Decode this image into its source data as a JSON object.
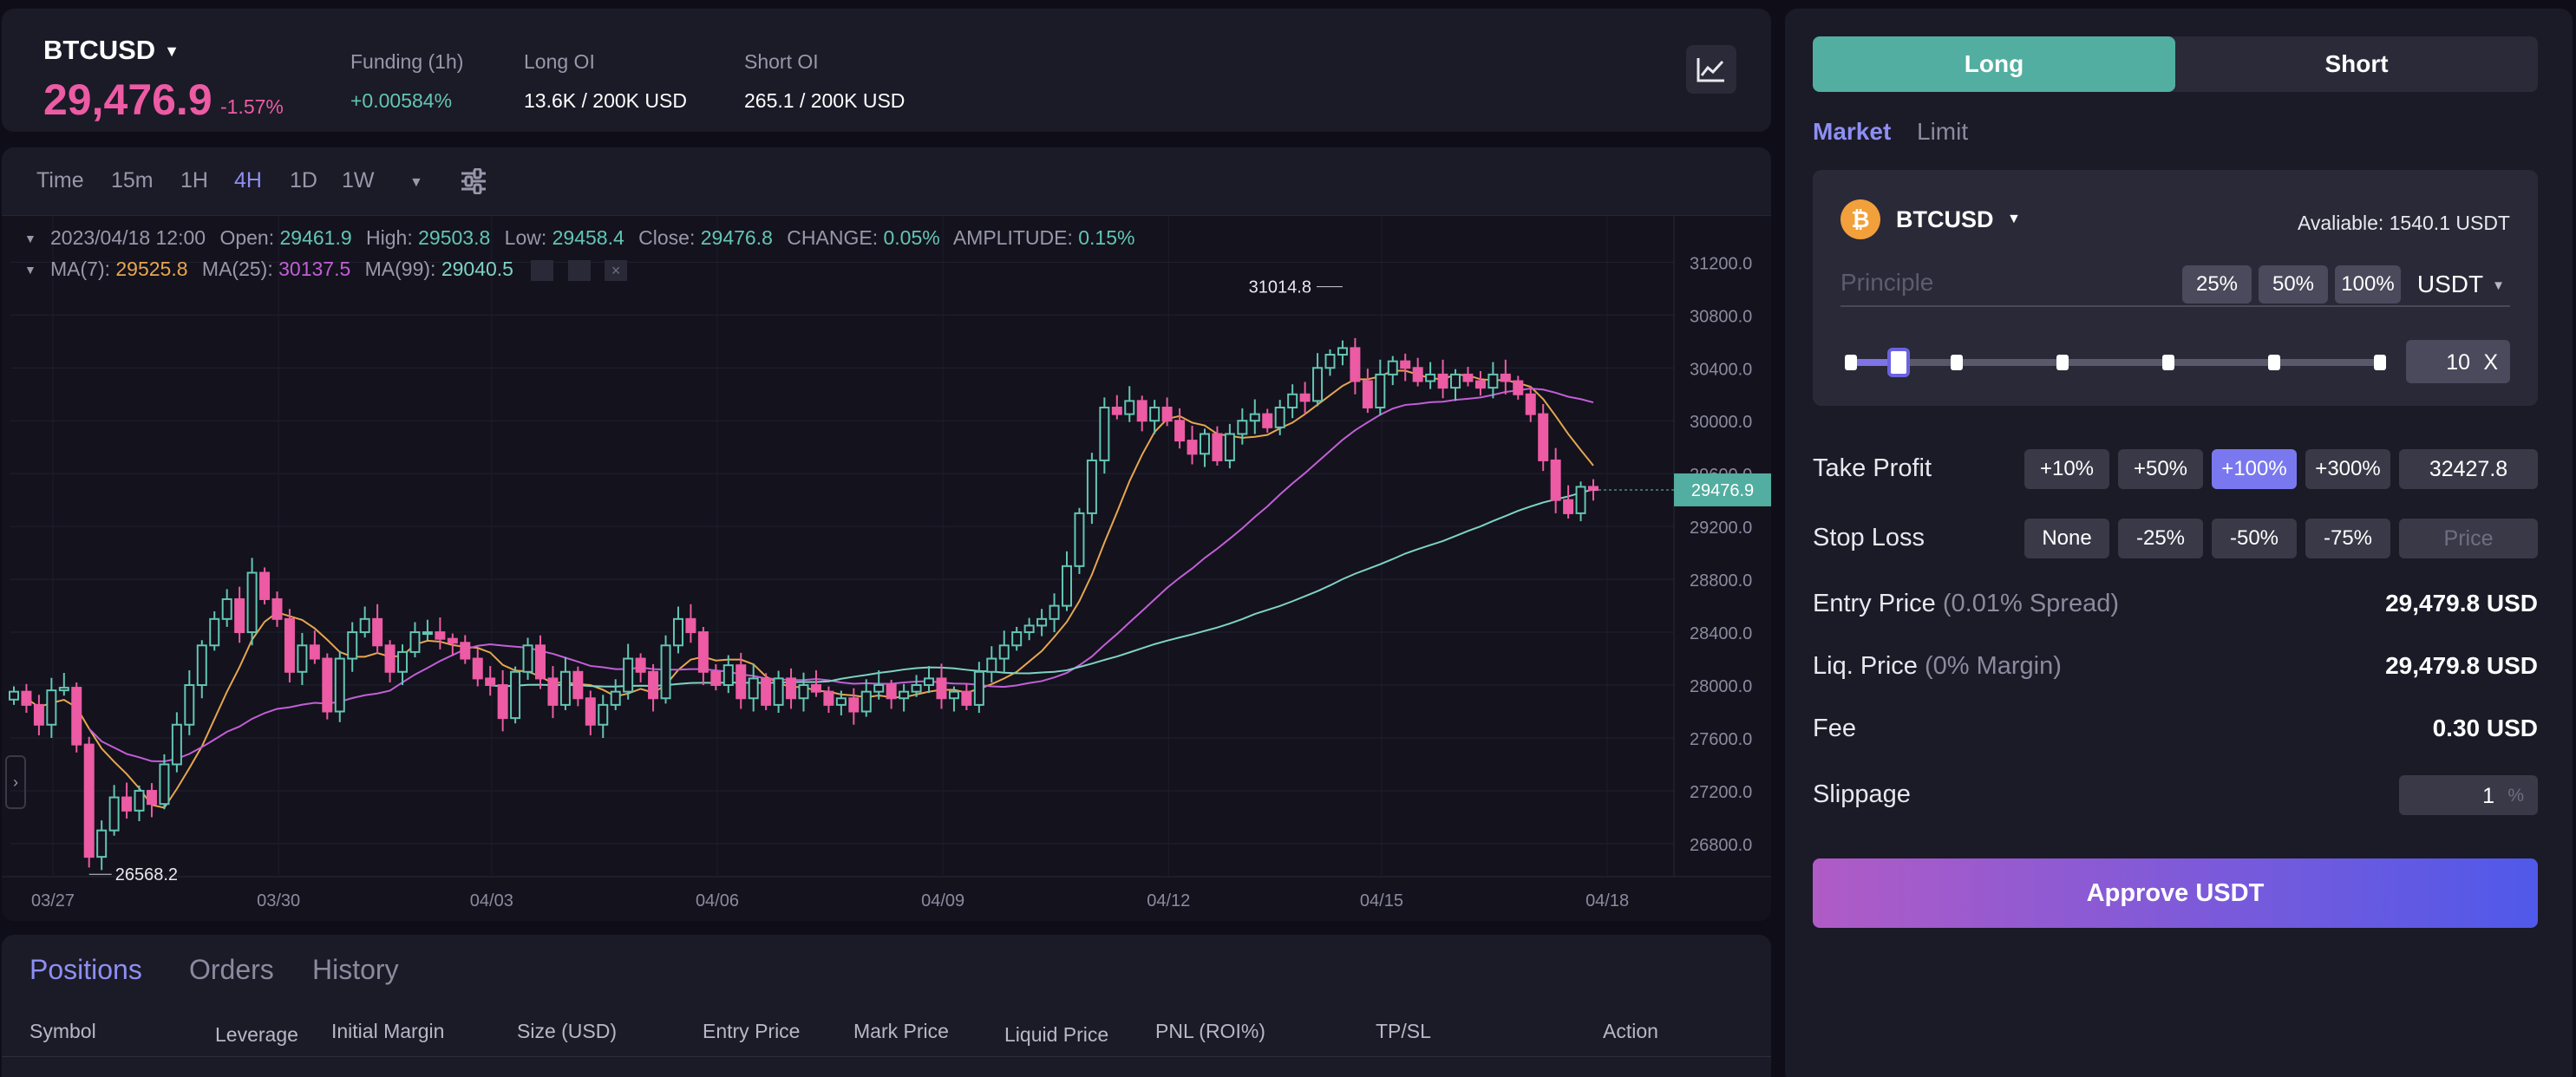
{
  "ticker": {
    "symbol": "BTCUSD",
    "price": "29,476.9",
    "change": "-1.57%",
    "funding_label": "Funding (1h)",
    "funding_value": "+0.00584%",
    "long_oi_label": "Long OI",
    "long_oi_value": "13.6K / 200K USD",
    "short_oi_label": "Short OI",
    "short_oi_value": "265.1 / 200K USD"
  },
  "toolbar": {
    "timeframes": [
      "Time",
      "15m",
      "1H",
      "4H",
      "1D",
      "1W"
    ],
    "active_timeframe": "4H"
  },
  "legend": {
    "date": "2023/04/18 12:00",
    "open_label": "Open:",
    "open": "29461.9",
    "high_label": "High:",
    "high": "29503.8",
    "low_label": "Low:",
    "low": "29458.4",
    "close_label": "Close:",
    "close": "29476.8",
    "change_label": "CHANGE:",
    "change": "0.05%",
    "amp_label": "AMPLITUDE:",
    "amplitude": "0.15%",
    "ma7_label": "MA(7):",
    "ma7": "29525.8",
    "ma25_label": "MA(25):",
    "ma25": "30137.5",
    "ma99_label": "MA(99):",
    "ma99": "29040.5"
  },
  "chart_data": {
    "type": "candlestick",
    "x_tick_labels": [
      "03/27",
      "03/30",
      "04/03",
      "04/06",
      "04/09",
      "04/12",
      "04/15",
      "04/18"
    ],
    "y_tick_labels": [
      "31200.0",
      "30800.0",
      "30400.0",
      "30000.0",
      "29600.0",
      "29200.0",
      "28800.0",
      "28400.0",
      "28000.0",
      "27600.0",
      "27200.0",
      "26800.0"
    ],
    "ylim": [
      26550,
      31550
    ],
    "last_price_label": "29476.9",
    "max_annotation": "31014.8",
    "min_annotation": "26568.2",
    "close_series": [
      27950,
      27850,
      27700,
      27960,
      27980,
      27550,
      26700,
      26900,
      27150,
      27050,
      27200,
      27100,
      27400,
      27700,
      28000,
      28300,
      28500,
      28650,
      28400,
      28850,
      28650,
      28500,
      28100,
      28300,
      28200,
      27800,
      28200,
      28400,
      28500,
      28300,
      28100,
      28250,
      28400,
      28400,
      28350,
      28320,
      28200,
      28050,
      28000,
      27750,
      28100,
      28300,
      28050,
      27850,
      28100,
      27900,
      27700,
      27850,
      27950,
      28200,
      28100,
      27900,
      28300,
      28500,
      28400,
      28100,
      28000,
      28150,
      27900,
      28050,
      27850,
      28050,
      27900,
      28000,
      27950,
      27850,
      27900,
      27800,
      27950,
      28000,
      27900,
      27950,
      28000,
      28050,
      27900,
      27950,
      27850,
      28100,
      28200,
      28300,
      28400,
      28450,
      28500,
      28600,
      28900,
      29300,
      29700,
      30100,
      30050,
      30150,
      30000,
      30100,
      30000,
      29850,
      29750,
      29900,
      29700,
      29900,
      30000,
      30050,
      29950,
      30100,
      30200,
      30150,
      30400,
      30500,
      30550,
      30300,
      30100,
      30350,
      30450,
      30400,
      30300,
      30350,
      30250,
      30350,
      30300,
      30250,
      30350,
      30300,
      30200,
      30050,
      29700,
      29400,
      29300,
      29500,
      29476
    ]
  },
  "positions": {
    "tabs": [
      "Positions",
      "Orders",
      "History"
    ],
    "columns": [
      "Symbol",
      "Leverage",
      "Initial Margin",
      "Size (USD)",
      "Entry Price",
      "Mark Price",
      "Liquid Price",
      "PNL (ROI%)",
      "TP/SL",
      "Action"
    ]
  },
  "trade": {
    "long_label": "Long",
    "short_label": "Short",
    "order_tabs": [
      "Market",
      "Limit"
    ],
    "coin": "BTCUSD",
    "coin_icon_glyph": "₿",
    "available": "Avaliable: 1540.1 USDT",
    "principle_placeholder": "Principle",
    "pct_buttons": [
      "25%",
      "50%",
      "100%"
    ],
    "currency": "USDT",
    "leverage": "10",
    "leverage_suffix": "X",
    "leverage_fraction": 0.09,
    "take_profit_label": "Take Profit",
    "tp_options": [
      "+10%",
      "+50%",
      "+100%",
      "+300%"
    ],
    "tp_active": "+100%",
    "tp_value": "32427.8",
    "stop_loss_label": "Stop Loss",
    "sl_options": [
      "None",
      "-25%",
      "-50%",
      "-75%"
    ],
    "sl_placeholder": "Price",
    "entry_label": "Entry Price",
    "entry_note": "(0.01% Spread)",
    "entry_value": "29,479.8 USD",
    "liq_label": "Liq. Price",
    "liq_note": "(0% Margin)",
    "liq_value": "29,479.8 USD",
    "fee_label": "Fee",
    "fee_value": "0.30 USD",
    "slippage_label": "Slippage",
    "slippage_value": "1",
    "slippage_unit": "%",
    "approve_label": "Approve USDT"
  },
  "colors": {
    "up": "#63c5b3",
    "down": "#ec5ba4",
    "accent": "#8d8ff2",
    "ma7": "#e6a64f",
    "ma25": "#c25fd6",
    "ma99": "#7fd3c4"
  }
}
